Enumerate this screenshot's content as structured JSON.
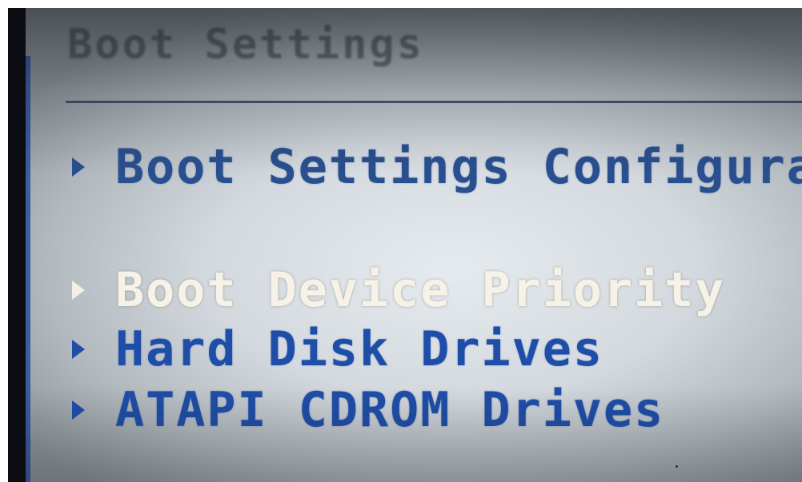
{
  "header": {
    "title": "Boot Settings"
  },
  "menu": {
    "items": [
      {
        "label": "Boot Settings Configuration",
        "selected": false
      },
      {
        "label": "Boot Device Priority",
        "selected": true
      },
      {
        "label": "Hard Disk Drives",
        "selected": false
      },
      {
        "label": "ATAPI CDROM Drives",
        "selected": false
      }
    ]
  },
  "colors": {
    "background": "#d3d9de",
    "item_text": "#1f4ea8",
    "selected_text": "#f7f2e8",
    "divider": "#2c3a55"
  },
  "icons": {
    "item_marker": "triangle-right-icon"
  }
}
